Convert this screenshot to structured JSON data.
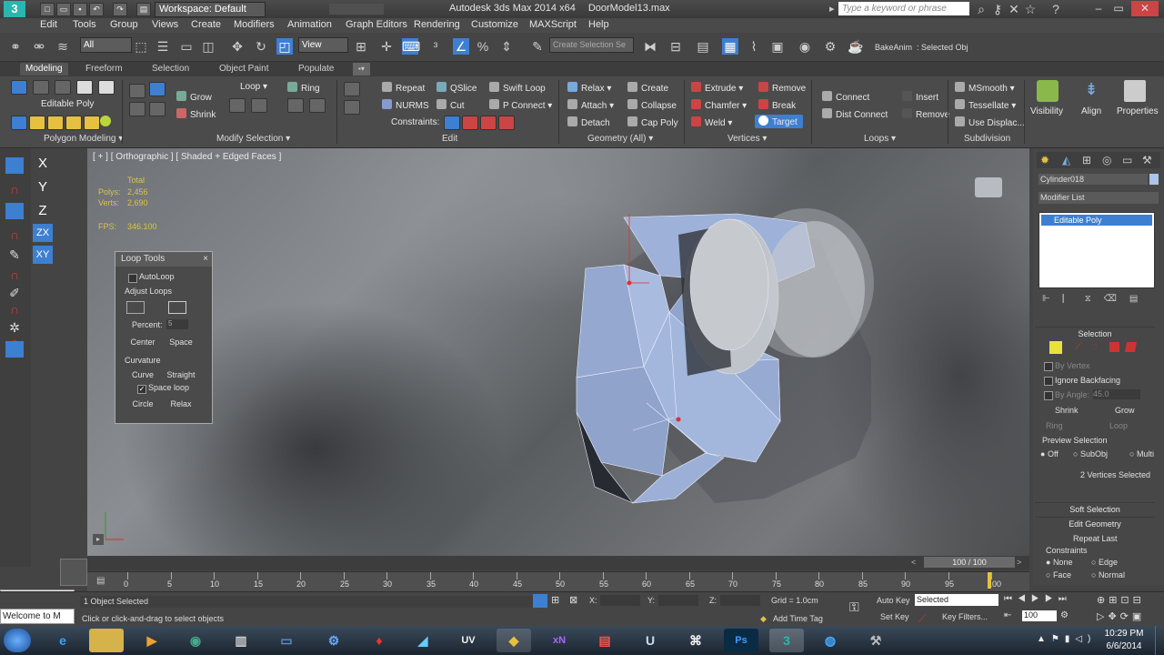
{
  "titlebar": {
    "workspace": "Workspace: Default",
    "app_title": "Autodesk 3ds Max 2014 x64",
    "file_name": "DoorModel13.max",
    "search_placeholder": "Type a keyword or phrase"
  },
  "menu": [
    "Edit",
    "Tools",
    "Group",
    "Views",
    "Create",
    "Modifiers",
    "Animation",
    "Graph Editors",
    "Rendering",
    "Customize",
    "MAXScript",
    "Help"
  ],
  "toolbar": {
    "selection_filter": "All",
    "reference_coord": "View",
    "named_selection_placeholder": "Create Selection Se",
    "bake_anim": "BakeAnim",
    "selected_obj": ": Selected Obj"
  },
  "ribbon_tabs": [
    "Modeling",
    "Freeform",
    "Selection",
    "Object Paint",
    "Populate"
  ],
  "ribbon": {
    "editable_poly": "Editable Poly",
    "grow": "Grow",
    "shrink": "Shrink",
    "loop": "Loop",
    "ring": "Ring",
    "repeat": "Repeat",
    "qslice": "QSlice",
    "swift_loop": "Swift Loop",
    "nurms": "NURMS",
    "cut": "Cut",
    "p_connect": "P Connect",
    "constraints": "Constraints:",
    "relax": "Relax",
    "create": "Create",
    "attach": "Attach",
    "collapse": "Collapse",
    "detach": "Detach",
    "cap_poly": "Cap Poly",
    "extrude": "Extrude",
    "remove": "Remove",
    "chamfer": "Chamfer",
    "break": "Break",
    "weld": "Weld",
    "target": "Target",
    "connect": "Connect",
    "dist_connect": "Dist Connect",
    "insert": "Insert",
    "remove2": "Remove",
    "msmooth": "MSmooth",
    "tessellate": "Tessellate",
    "use_displac": "Use Displac...",
    "visibility": "Visibility",
    "align": "Align",
    "properties": "Properties",
    "groups": [
      "Polygon Modeling",
      "Modify Selection",
      "Edit",
      "Geometry (All)",
      "Vertices",
      "Loops",
      "Subdivision"
    ]
  },
  "axis_buttons": [
    "X",
    "Y",
    "Z",
    "ZX",
    "XY"
  ],
  "viewport": {
    "label": "[ + ] [ Orthographic ] [ Shaded + Edged Faces ]",
    "stats_total": "Total",
    "polys_label": "Polys:",
    "polys_value": "2,456",
    "verts_label": "Verts:",
    "verts_value": "2,690",
    "fps_label": "FPS:",
    "fps_value": "346.100"
  },
  "loop_tools": {
    "title": "Loop Tools",
    "autoloop": "AutoLoop",
    "adjust_loops": "Adjust Loops",
    "percent_label": "Percent:",
    "percent_value": "5",
    "center": "Center",
    "space": "Space",
    "curvature": "Curvature",
    "curve": "Curve",
    "straight": "Straight",
    "space_loop": "Space loop",
    "circle": "Circle",
    "relax": "Relax"
  },
  "command_panel": {
    "object_name": "Cylinder018",
    "modifier_list": "Modifier List",
    "stack_item": "Editable Poly",
    "selection_header": "Selection",
    "by_vertex": "By Vertex",
    "ignore_backfacing": "Ignore Backfacing",
    "by_angle": "By Angle:",
    "angle_value": "45.0",
    "shrink": "Shrink",
    "grow": "Grow",
    "ring": "Ring",
    "loop": "Loop",
    "preview_selection": "Preview Selection",
    "off": "Off",
    "subobj": "SubObj",
    "multi": "Multi",
    "vertices_selected": "2 Vertices Selected",
    "soft_selection": "Soft Selection",
    "edit_geometry": "Edit Geometry",
    "repeat_last": "Repeat Last",
    "constraints": "Constraints",
    "none": "None",
    "edge": "Edge",
    "face": "Face",
    "normal": "Normal"
  },
  "timeline": {
    "frame_counter": "100 / 100",
    "ticks": [
      "0",
      "5",
      "10",
      "15",
      "20",
      "25",
      "30",
      "35",
      "40",
      "45",
      "50",
      "55",
      "60",
      "65",
      "70",
      "75",
      "80",
      "85",
      "90",
      "95",
      "100"
    ]
  },
  "status": {
    "script_listener": "Welcome to M",
    "objects_selected": "1 Object Selected",
    "prompt": "Click or click-and-drag to select objects",
    "x_label": "X:",
    "y_label": "Y:",
    "z_label": "Z:",
    "grid": "Grid = 1.0cm",
    "add_time_tag": "Add Time Tag",
    "auto_key": "Auto Key",
    "set_key": "Set Key",
    "key_mode": "Selected",
    "key_filters": "Key Filters...",
    "frame_value": "100"
  },
  "taskbar": {
    "time": "10:29 PM",
    "date": "6/6/2014"
  },
  "colors": {
    "selection_blue": "#9fb6e0",
    "active_blue": "#3d7fd1",
    "vertex_red": "#e03030"
  }
}
